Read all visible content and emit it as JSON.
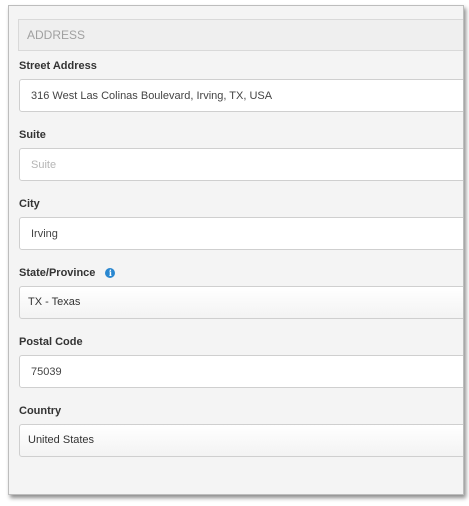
{
  "section": {
    "title": "ADDRESS"
  },
  "fields": {
    "street": {
      "label": "Street Address",
      "value": "316 West Las Colinas Boulevard, Irving, TX, USA"
    },
    "suite": {
      "label": "Suite",
      "value": "",
      "placeholder": "Suite"
    },
    "city": {
      "label": "City",
      "value": "Irving"
    },
    "state": {
      "label": "State/Province",
      "value": "TX - Texas",
      "info_icon": "info-icon"
    },
    "postal": {
      "label": "Postal Code",
      "value": "75039"
    },
    "country": {
      "label": "Country",
      "value": "United States"
    }
  },
  "colors": {
    "panel_bg": "#f4f4f4",
    "info_icon": "#2a87d0"
  }
}
